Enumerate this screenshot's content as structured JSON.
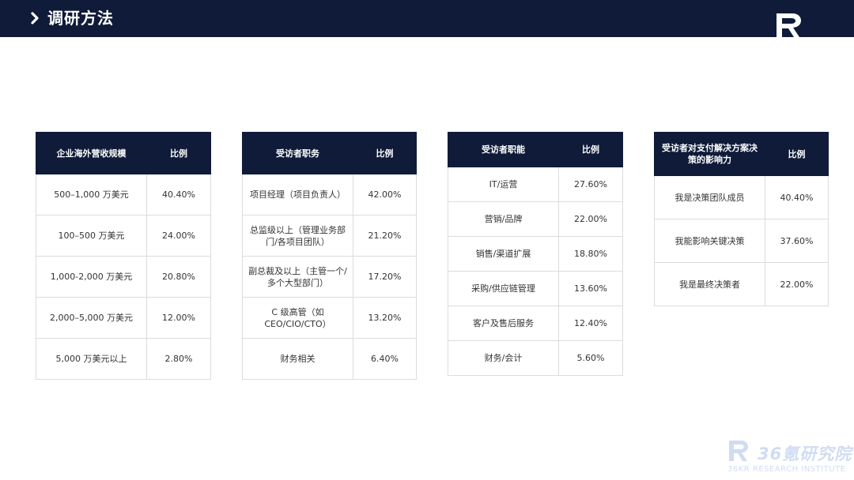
{
  "header": {
    "title": "调研方法"
  },
  "tables": [
    {
      "headers": [
        "企业海外营收规模",
        "比例"
      ],
      "rows": [
        [
          "500–1,000 万美元",
          "40.40%"
        ],
        [
          "100–500 万美元",
          "24.00%"
        ],
        [
          "1,000-2,000 万美元",
          "20.80%"
        ],
        [
          "2,000–5,000 万美元",
          "12.00%"
        ],
        [
          "5,000 万美元以上",
          "2.80%"
        ]
      ]
    },
    {
      "headers": [
        "受访者职务",
        "比例"
      ],
      "rows": [
        [
          "项目经理（项目负责人）",
          "42.00%"
        ],
        [
          "总监级以上（管理业务部门/各项目团队）",
          "21.20%"
        ],
        [
          "副总裁及以上（主管一个/多个大型部门）",
          "17.20%"
        ],
        [
          "C 级高管（如CEO/CIO/CTO）",
          "13.20%"
        ],
        [
          "财务相关",
          "6.40%"
        ]
      ]
    },
    {
      "headers": [
        "受访者职能",
        "比例"
      ],
      "rows": [
        [
          "IT/运营",
          "27.60%"
        ],
        [
          "营销/品牌",
          "22.00%"
        ],
        [
          "销售/渠道扩展",
          "18.80%"
        ],
        [
          "采购/供应链管理",
          "13.60%"
        ],
        [
          "客户及售后服务",
          "12.40%"
        ],
        [
          "财务/会计",
          "5.60%"
        ]
      ]
    },
    {
      "headers": [
        "受访者对支付解决方案决策的影响力",
        "比例"
      ],
      "rows": [
        [
          "我是决策团队成员",
          "40.40%"
        ],
        [
          "我能影响关键决策",
          "37.60%"
        ],
        [
          "我是最终决策者",
          "22.00%"
        ]
      ]
    }
  ],
  "watermark": {
    "text": "36氪研究院",
    "subtext": "36KR RESEARCH INSTITUTE"
  }
}
